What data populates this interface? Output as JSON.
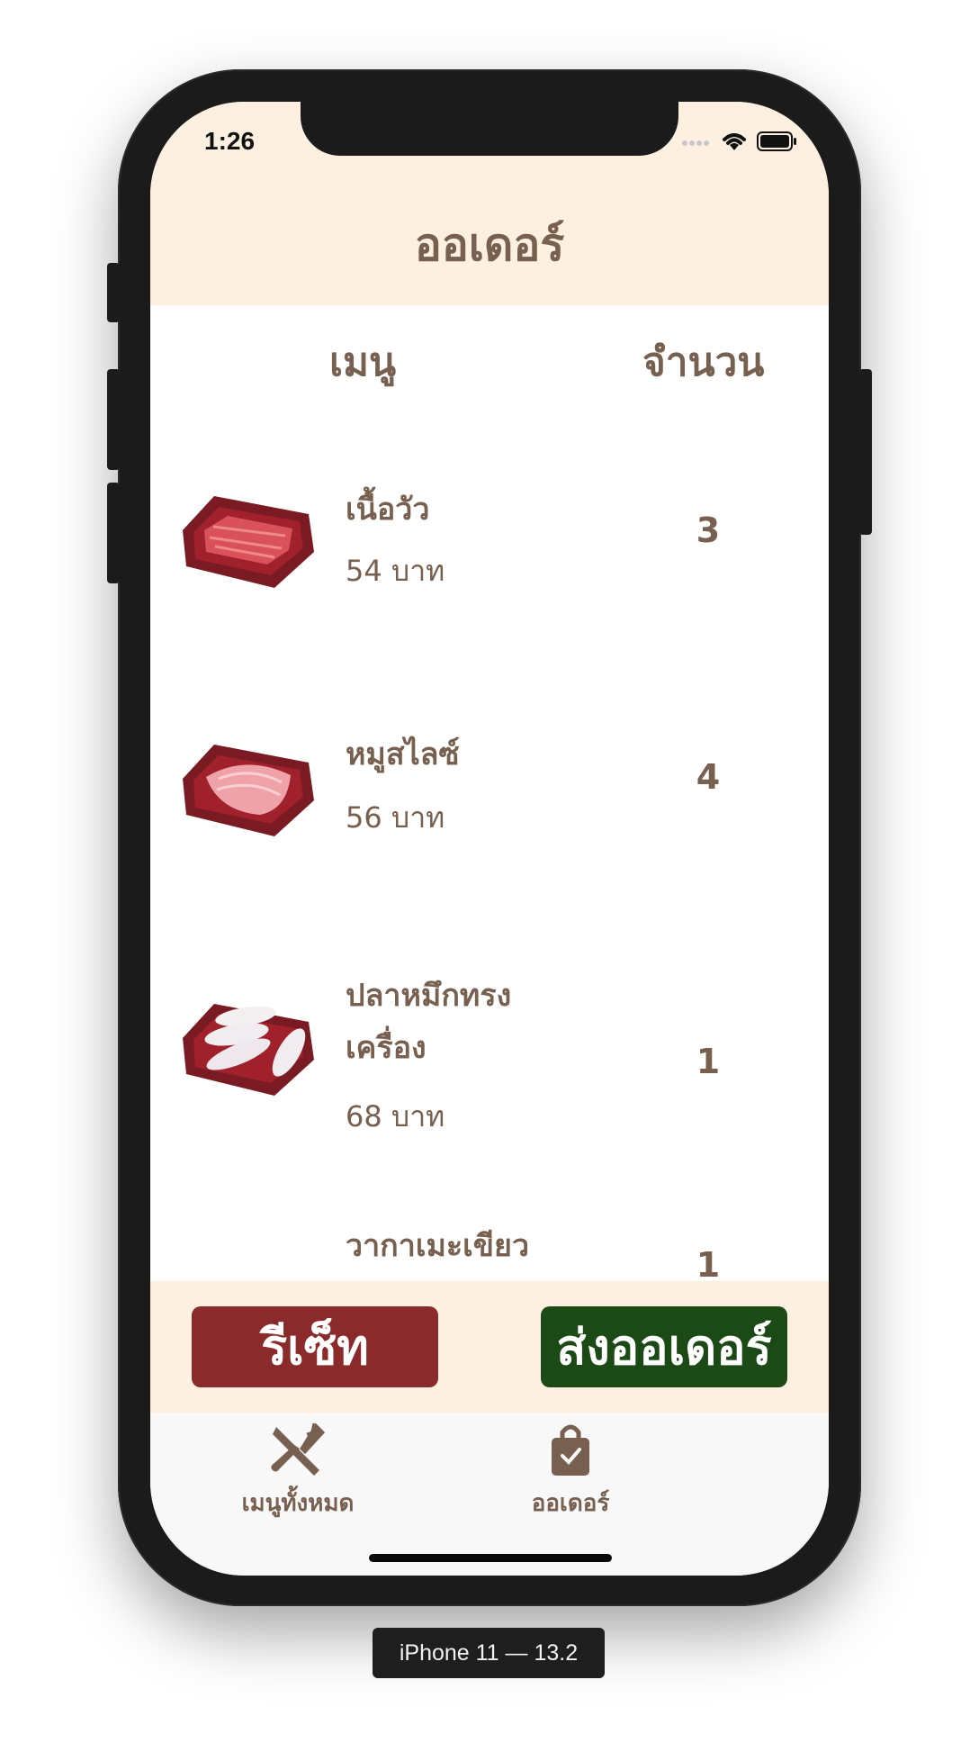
{
  "status_bar": {
    "time": "1:26"
  },
  "header": {
    "title": "ออเดอร์"
  },
  "columns": {
    "menu": "เมนู",
    "quantity": "จำนวน"
  },
  "items": [
    {
      "name": "เนื้อวัว",
      "price": "54 บาท",
      "qty": "3",
      "image": "beef-plate"
    },
    {
      "name": "หมูสไลซ์",
      "price": "56 บาท",
      "qty": "4",
      "image": "pork-plate"
    },
    {
      "name": "ปลาหมึกทรงเครื่อง",
      "price": "68 บาท",
      "qty": "1",
      "image": "squid-plate"
    },
    {
      "name": "วากาเมะเขียว",
      "price": "",
      "qty": "1",
      "image": "seaweed-plate"
    }
  ],
  "actions": {
    "reset": "รีเซ็ท",
    "send": "ส่งออเดอร์"
  },
  "tabs": [
    {
      "label": "เมนูทั้งหมด",
      "icon": "utensils-icon"
    },
    {
      "label": "ออเดอร์",
      "icon": "shopping-bag-icon"
    }
  ],
  "simulator_label": "iPhone 11 — 13.2",
  "colors": {
    "header_bg": "#fdf0e0",
    "text_brown": "#77604f",
    "reset_red": "#8a2a2b",
    "send_green": "#1c4a17"
  }
}
